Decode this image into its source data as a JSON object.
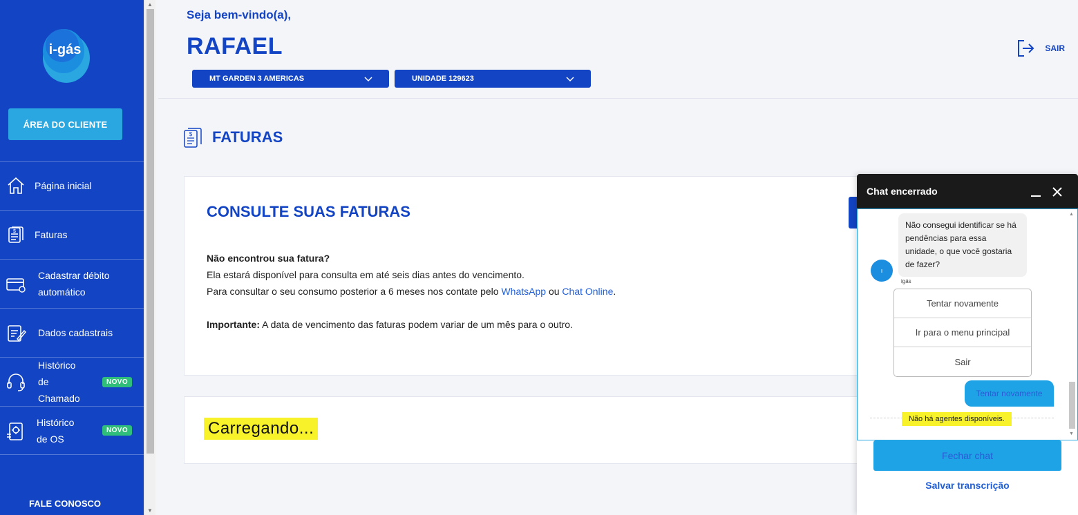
{
  "brand": {
    "logo_text": "i-gás"
  },
  "sidebar": {
    "area_button": "ÁREA DO CLIENTE",
    "items": [
      {
        "label_lines": [
          "Página inicial"
        ],
        "icon": "home-icon"
      },
      {
        "label_lines": [
          "Faturas"
        ],
        "icon": "invoice-icon"
      },
      {
        "label_lines": [
          "Cadastrar débito",
          "automático"
        ],
        "icon": "credit-card-icon"
      },
      {
        "label_lines": [
          "Dados cadastrais"
        ],
        "icon": "clipboard-edit-icon"
      },
      {
        "label_lines": [
          "Histórico",
          "de",
          "Chamado"
        ],
        "icon": "headset-icon",
        "badge": "NOVO"
      },
      {
        "label_lines": [
          "Histórico",
          "de OS"
        ],
        "icon": "service-order-icon",
        "badge": "NOVO"
      }
    ],
    "footer": "FALE CONOSCO"
  },
  "header": {
    "welcome": "Seja bem-vindo(a),",
    "username": "RAFAEL",
    "condo_select": "MT GARDEN 3 AMERICAS",
    "unit_select": "UNIDADE 129623",
    "logout": "SAIR"
  },
  "page": {
    "title": "FATURAS",
    "card_title": "CONSULTE SUAS FATURAS",
    "q": "Não encontrou sua fatura?",
    "line1": "Ela estará disponível para consulta em até seis dias antes do vencimento.",
    "line2_pre": "Para consultar o seu consumo posterior a 6 meses nos contate pelo ",
    "line2_link1": "WhatsApp",
    "line2_mid": " ou ",
    "line2_link2": "Chat Online",
    "line2_post": ".",
    "important_label": "Importante:",
    "important_text": " A data de vencimento das faturas podem variar de um mês para o outro.",
    "loading": "Carregando..."
  },
  "chat": {
    "title": "Chat encerrado",
    "bot_message": "Não consegui identificar se há pendências para essa unidade, o que você gostaria de fazer?",
    "bot_name": "igás",
    "options": [
      "Tentar novamente",
      "Ir para o menu principal",
      "Sair"
    ],
    "user_message": "Tentar novamente",
    "system_message": "Não há agentes disponíveis.",
    "close_button": "Fechar chat",
    "save_link": "Salvar transcrição"
  },
  "colors": {
    "primary": "#1244c4",
    "accent": "#2aa6e0",
    "badge": "#2fbf7a",
    "highlight": "#f7f229"
  }
}
